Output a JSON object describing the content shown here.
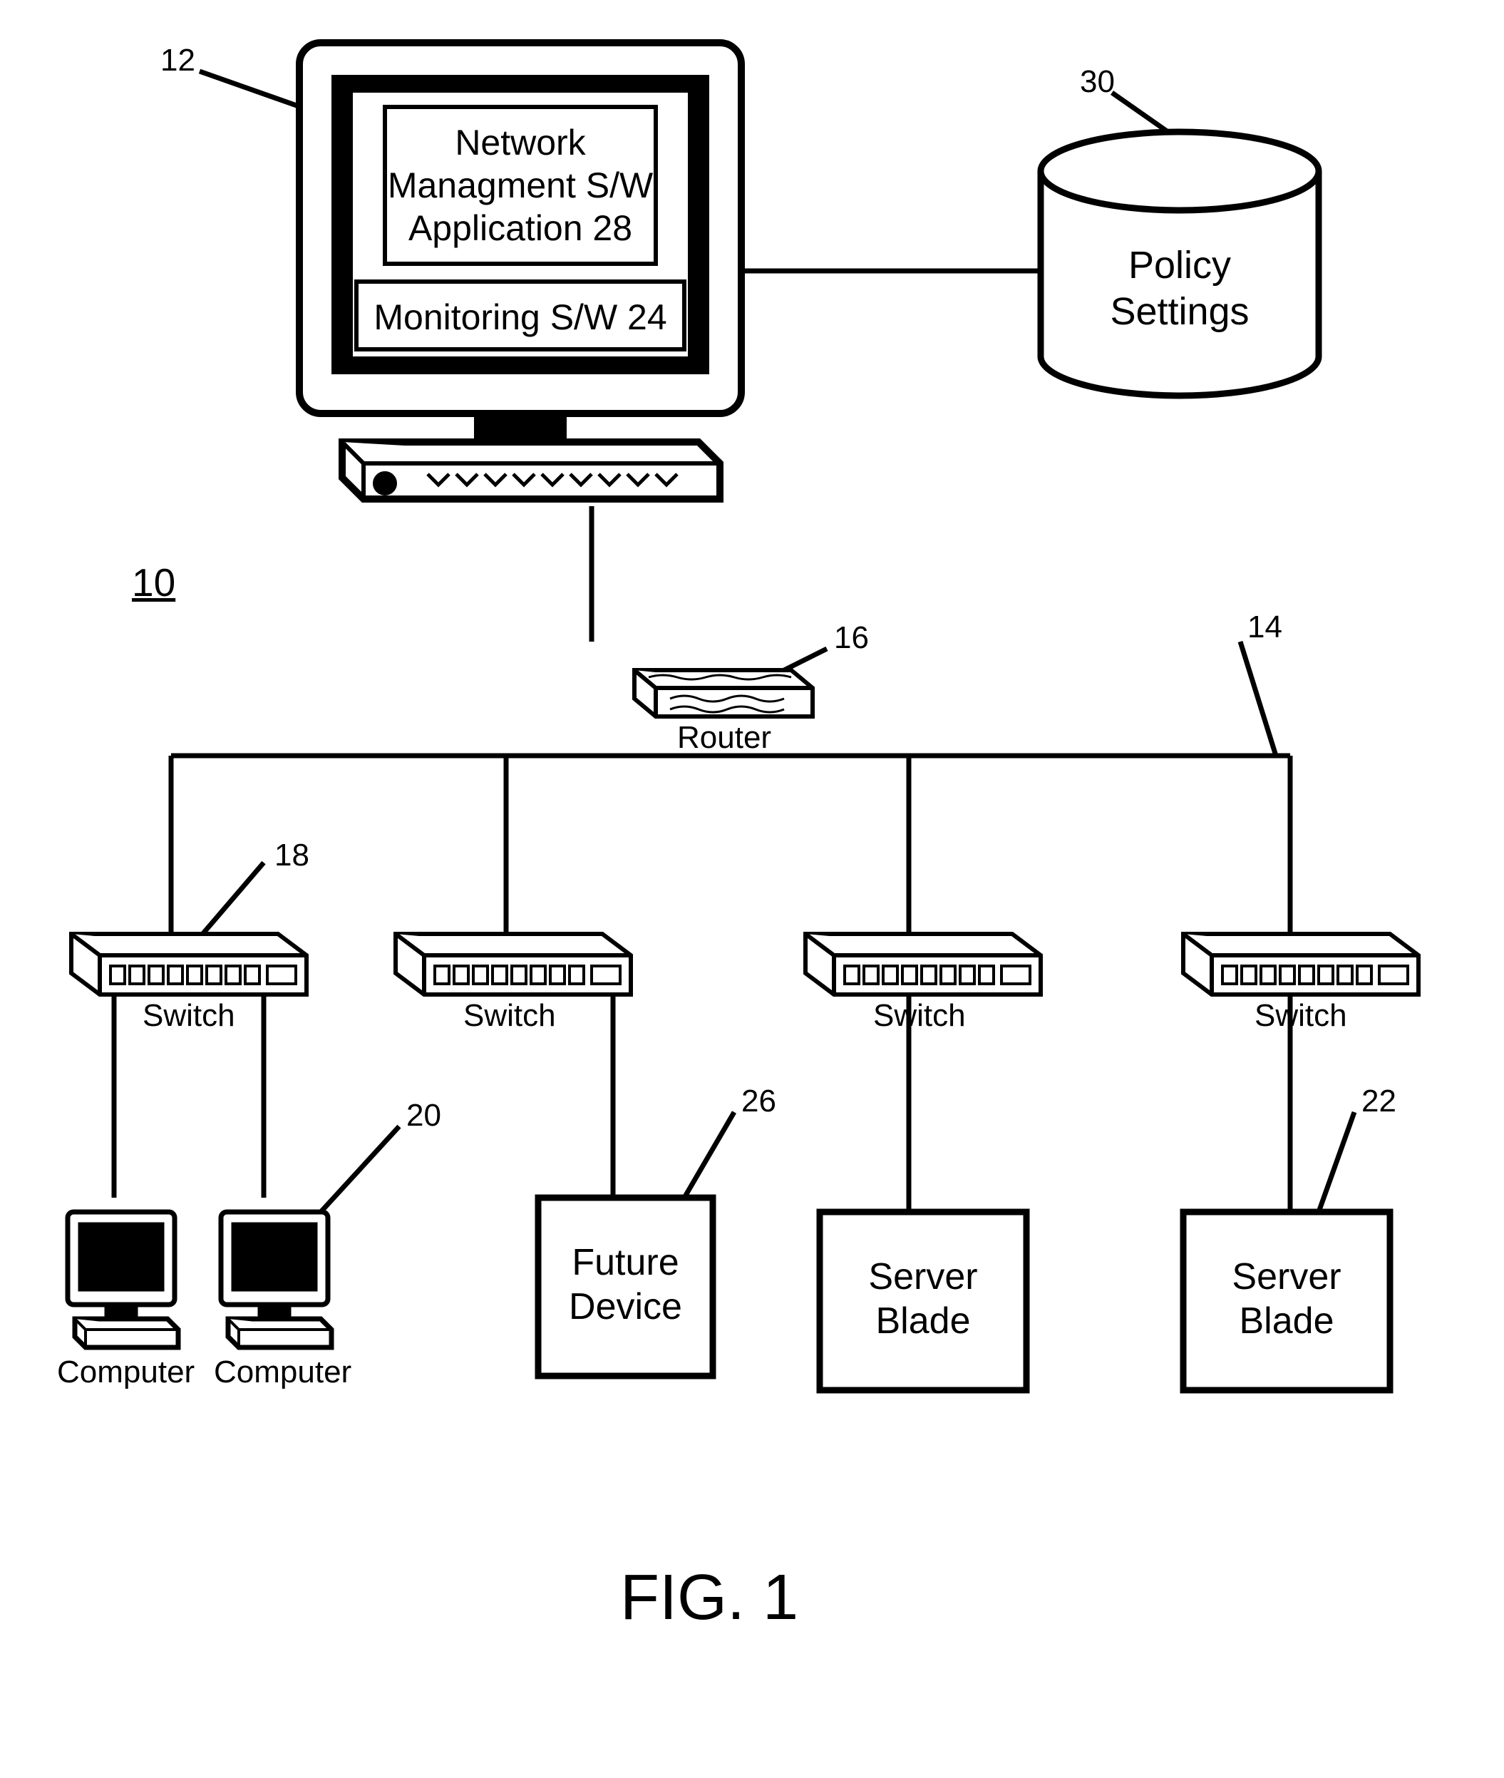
{
  "labels": {
    "ref10": "10",
    "ref12": "12",
    "ref14": "14",
    "ref16": "16",
    "ref18": "18",
    "ref20": "20",
    "ref22": "22",
    "ref26": "26",
    "ref30": "30",
    "router": "Router",
    "switch1": "Switch",
    "switch2": "Switch",
    "switch3": "Switch",
    "switch4": "Switch",
    "computer1": "Computer",
    "computer2": "Computer",
    "fig": "FIG. 1"
  },
  "boxes": {
    "nmapp": "Network\nManagment S/W\nApplication 28",
    "monitoring": "Monitoring S/W 24",
    "policy": "Policy\nSettings",
    "future": "Future\nDevice",
    "server1": "Server\nBlade",
    "server2": "Server\nBlade"
  }
}
